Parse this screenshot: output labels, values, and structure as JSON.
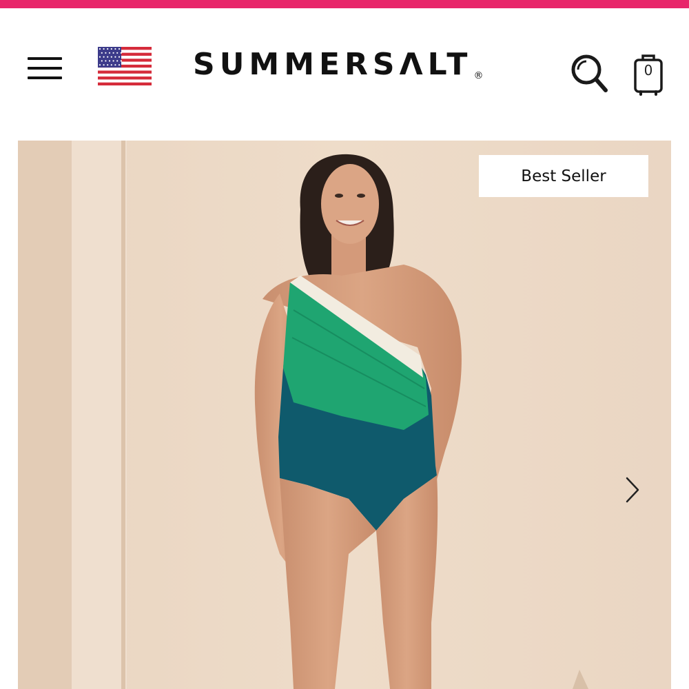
{
  "colors": {
    "top_stripe": "#e8266a",
    "background": "#ffffff",
    "hero_wall": "#ecd9c6",
    "text": "#111111",
    "suit_cream": "#f2ece0",
    "suit_green": "#1fa571",
    "suit_teal": "#0f5a6c"
  },
  "header": {
    "menu_icon": "hamburger-menu-icon",
    "flag_icon": "us-flag-icon",
    "logo_text": "SUMMERSΛLT",
    "logo_mark": "®",
    "search_icon": "search-icon",
    "cart_icon": "shopping-bag-icon",
    "cart_count": "0"
  },
  "hero": {
    "badge": "Best Seller",
    "next_icon": "chevron-right-icon",
    "image": "model-in-one-shoulder-swimsuit"
  }
}
